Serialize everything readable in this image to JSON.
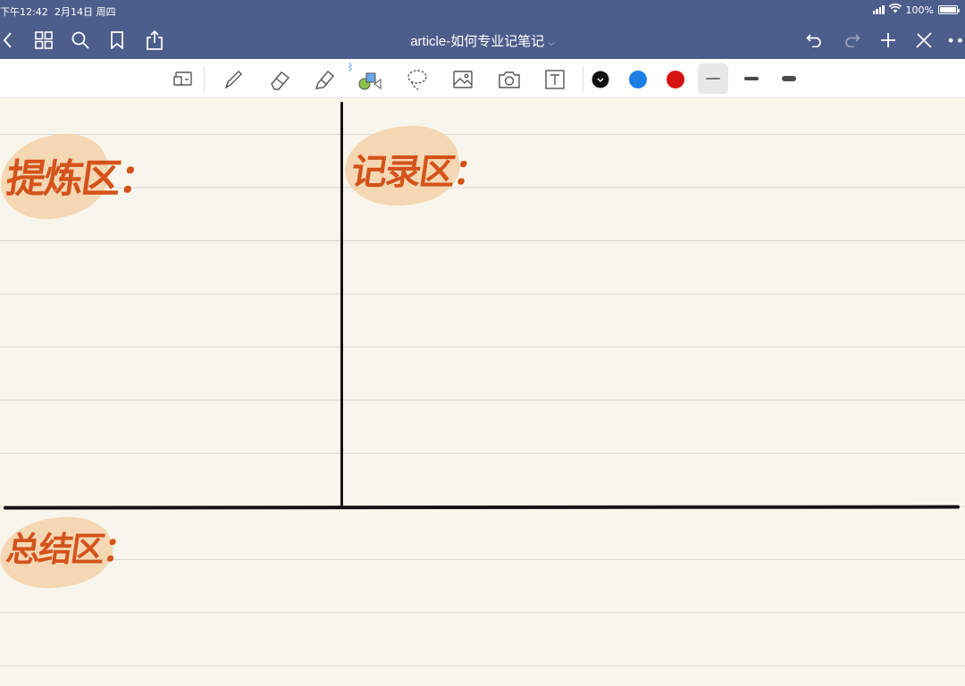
{
  "status_bar": {
    "time": "下午12:42",
    "date": "2月14日 周四",
    "battery": "100%",
    "battery_level": 1.0
  },
  "nav_bar": {
    "title": "article-如何专业记笔记",
    "title_chevron_icon": "chevron-down-icon",
    "left_icons": [
      "back-chevron-icon",
      "grid-icon",
      "search-icon",
      "bookmark-icon",
      "share-icon"
    ],
    "right_icons": [
      "undo-icon",
      "redo-icon",
      "add-icon",
      "close-tools-icon",
      "more-icon"
    ]
  },
  "toolbar": {
    "tools": [
      "zoom-window-icon",
      "pen-icon",
      "eraser-icon",
      "highlighter-icon",
      "shapes-icon",
      "lasso-icon",
      "image-icon",
      "camera-icon",
      "text-icon"
    ],
    "bluetooth_icon": "bluetooth-icon",
    "colors": [
      "#111111",
      "#1b7fe6",
      "#d6140f"
    ],
    "selected_color": "#111111",
    "stroke_widths": [
      "thin",
      "medium",
      "thick"
    ],
    "selected_stroke": "thin"
  },
  "page": {
    "handwritten_labels": {
      "extract": "提炼区：",
      "notes": "记录区：",
      "summary": "总结区："
    },
    "highlight_color": "#f4d4ae",
    "ink_color": "#d4531a",
    "divider_color": "#141414"
  }
}
